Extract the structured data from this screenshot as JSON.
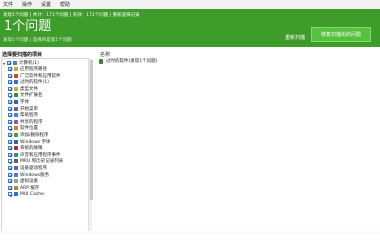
{
  "menu": [
    "文件",
    "操作",
    "设置",
    "帮助"
  ],
  "banner": {
    "status": "发现1个问题 | 共计：171个问题 | 有效：171个问题 | 重新选择记录",
    "big_text": "1个问题",
    "sub_text": "发现1个问题 | 选择的是第1个问题",
    "rescan_label": "重新扫描",
    "fix_label": "修复扫描出的问题"
  },
  "left": {
    "title": "选择要扫描的项目",
    "root": "计算机(1)",
    "items": [
      {
        "label": "应用程序路径",
        "icon_color": "#d9a21c"
      },
      {
        "label": "广泛软件和应用软件",
        "icon_color": "#c04b2a"
      },
      {
        "label": "过时的软件(1)",
        "icon_color": "#2f6fd1"
      },
      {
        "label": "类型文件",
        "icon_color": "#c9a24a"
      },
      {
        "label": "文件扩展名",
        "icon_color": "#3b8a3b"
      },
      {
        "label": "字体",
        "icon_color": "#2b63c2"
      },
      {
        "label": "开始菜单",
        "icon_color": "#6a6a6a"
      },
      {
        "label": "帮助程序",
        "icon_color": "#3f87d6"
      },
      {
        "label": "共享的程序",
        "icon_color": "#8a5bb5"
      },
      {
        "label": "软件位置",
        "icon_color": "#d77b20"
      },
      {
        "label": "添加/删除程序",
        "icon_color": "#4a9b4a"
      },
      {
        "label": "Windows 字体",
        "icon_color": "#3a5fa0"
      },
      {
        "label": "系统的故障",
        "icon_color": "#b33030"
      },
      {
        "label": "声音和应用程序事件",
        "icon_color": "#2c8f8f"
      },
      {
        "label": "MRU 和历史记录列表",
        "icon_color": "#606060"
      },
      {
        "label": "设备驱动程序",
        "icon_color": "#5a5ad1"
      },
      {
        "label": "Windows服务",
        "icon_color": "#4f7fbf"
      },
      {
        "label": "虚拟设备",
        "icon_color": "#9a9a9a"
      },
      {
        "label": "ARP 缓存",
        "icon_color": "#c0802e"
      },
      {
        "label": "MUI Cache",
        "icon_color": "#2f6fd1"
      }
    ]
  },
  "right": {
    "column_header": "名称",
    "rows": [
      "过时的软件(发现1个问题)"
    ]
  },
  "colors": {
    "banner": "#3e9c2b",
    "fix_button": "#56c13e"
  }
}
